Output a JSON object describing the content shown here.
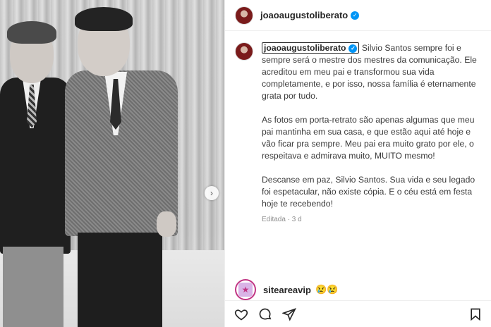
{
  "post": {
    "username": "joaoaugustoliberato",
    "verified": true
  },
  "caption": {
    "username": "joaoaugustoliberato",
    "paragraphs": [
      "Silvio Santos sempre foi e sempre será o mestre dos mestres da comunicação. Ele acreditou em meu pai e transformou sua vida completamente, e por isso, nossa família é eternamente grata por tudo.",
      "As fotos em porta-retrato são apenas algumas que meu pai mantinha em sua casa, e que estão aqui até hoje e vão ficar pra sempre. Meu pai era muito grato por ele, o respeitava e admirava muito, MUITO mesmo!",
      "Descanse em paz, Silvio Santos. Sua vida e seu legado foi espetacular, não existe cópia. E o céu está em festa hoje te recebendo!"
    ],
    "meta": "Editada · 3 d"
  },
  "comment": {
    "username": "siteareavip",
    "text": "😢😢"
  },
  "icons": {
    "like": "heart-icon",
    "comment": "comment-icon",
    "share": "share-icon",
    "next": "chevron-right-icon"
  },
  "colors": {
    "verified": "#0095f6",
    "story_ring": "#c13584"
  }
}
